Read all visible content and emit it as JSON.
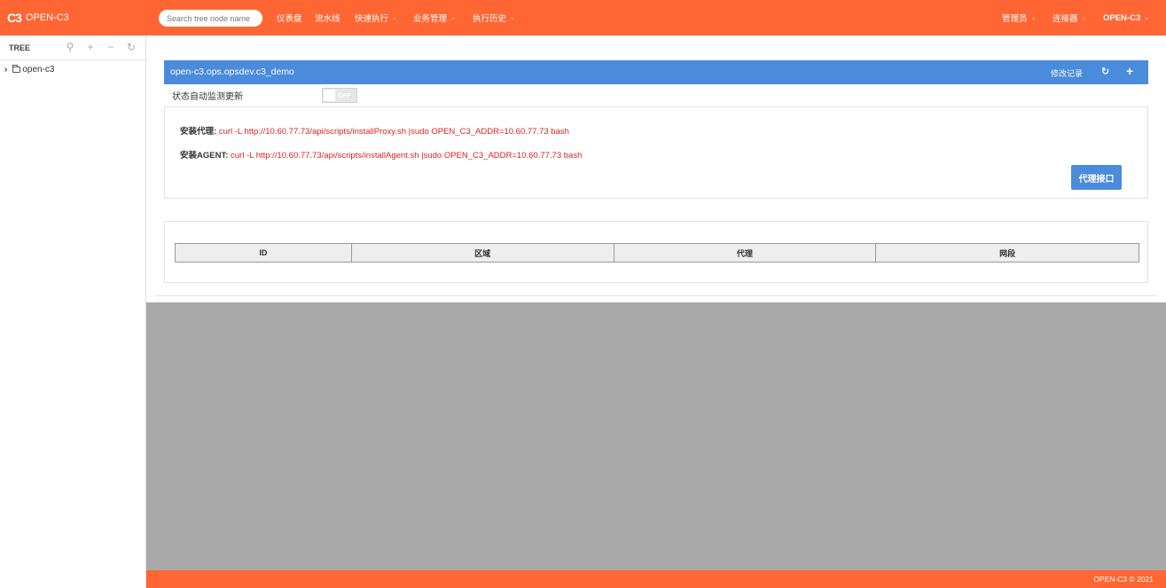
{
  "topbar": {
    "logo": "C3",
    "brand": "OPEN-C3",
    "search_placeholder": "Search tree node name",
    "nav": [
      {
        "label": "仪表盘",
        "dropdown": false
      },
      {
        "label": "流水线",
        "dropdown": false
      },
      {
        "label": "快速执行",
        "dropdown": true
      },
      {
        "label": "业务管理",
        "dropdown": true
      },
      {
        "label": "执行历史",
        "dropdown": true
      }
    ],
    "right_nav": [
      {
        "label": "管理员",
        "dropdown": true
      },
      {
        "label": "连接器",
        "dropdown": true
      },
      {
        "label": "OPEN-C3",
        "dropdown": true
      }
    ],
    "caret": "⌄"
  },
  "sidebar": {
    "title": "TREE",
    "tools": {
      "locate": "⚲",
      "add": "+",
      "remove": "−",
      "refresh": "↻"
    },
    "node": {
      "label": "open-c3",
      "chevron": "›"
    }
  },
  "panel": {
    "title": "open-c3.ops.opsdev.c3_demo",
    "log_link": "修改记录",
    "refresh": "↻",
    "add": "+"
  },
  "auto_monitor": {
    "label": "状态自动监测更新",
    "toggle_state": "OFF"
  },
  "install": {
    "proxy_label": "安装代理:",
    "proxy_cmd": "curl -L http://10.60.77.73/api/scripts/installProxy.sh |sudo OPEN_C3_ADDR=10.60.77.73 bash",
    "agent_label": "安装AGENT:",
    "agent_cmd": "curl -L http://10.60.77.73/api/scripts/installAgent.sh |sudo OPEN_C3_ADDR=10.60.77.73 bash",
    "proxy_button": "代理接口"
  },
  "table": {
    "columns": [
      "ID",
      "区域",
      "代理",
      "网段"
    ]
  },
  "footer": {
    "text": "OPEN-C3 © 2021"
  },
  "colors": {
    "brand_orange": "#ff6633",
    "panel_blue": "#4a8bdc",
    "command_red": "#e02020",
    "backdrop_grey": "#a9a9a9"
  }
}
